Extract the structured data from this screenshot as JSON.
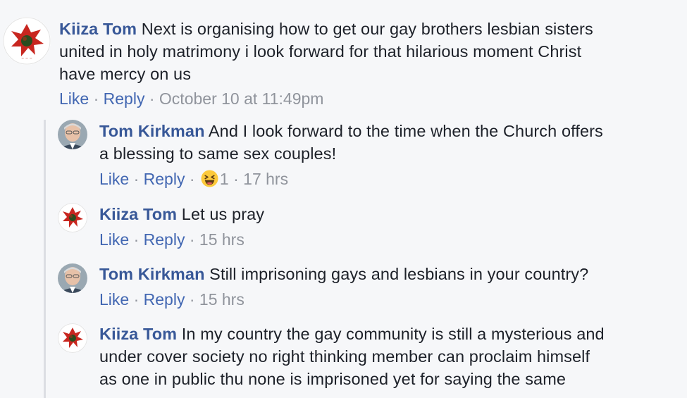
{
  "comments": [
    {
      "author": "Kiiza Tom",
      "text_lines": [
        "Next is organising how to get our gay brothers lesbian sisters",
        "united in holy matrimony i look forward for that hilarious moment Christ",
        "have mercy on us"
      ],
      "like_label": "Like",
      "reply_label": "Reply",
      "timestamp": "October 10 at 11:49pm",
      "avatar_icon": "kiiza-tom-avatar"
    },
    {
      "author": "Tom Kirkman",
      "text_lines": [
        "And I look forward to the time when the Church offers",
        "a blessing to same sex couples!"
      ],
      "like_label": "Like",
      "reply_label": "Reply",
      "reaction_icon": "laughing-face-emoji",
      "reaction_count": "1",
      "timestamp": "17 hrs",
      "avatar_icon": "tom-kirkman-avatar"
    },
    {
      "author": "Kiiza Tom",
      "text_lines": [
        "Let us pray"
      ],
      "like_label": "Like",
      "reply_label": "Reply",
      "timestamp": "15 hrs",
      "avatar_icon": "kiiza-tom-avatar"
    },
    {
      "author": "Tom Kirkman",
      "text_lines": [
        "Still imprisoning gays and lesbians in your country?"
      ],
      "like_label": "Like",
      "reply_label": "Reply",
      "timestamp": "15 hrs",
      "avatar_icon": "tom-kirkman-avatar"
    },
    {
      "author": "Kiiza Tom",
      "text_lines": [
        "In my country the gay community is still a mysterious and",
        "under cover society no right thinking member can proclaim himself",
        "as one in public thu none is imprisoned yet for saying the same"
      ],
      "avatar_icon": "kiiza-tom-avatar"
    }
  ],
  "colors": {
    "background": "#f6f7f9",
    "author_link": "#385898",
    "action_link": "#4267b2",
    "meta_gray": "#90949c",
    "thread_line": "#dcdee3"
  }
}
